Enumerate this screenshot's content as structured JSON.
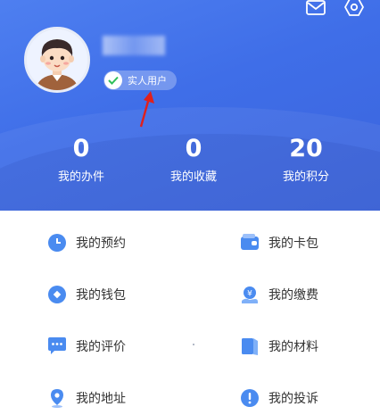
{
  "profile": {
    "verified_label": "实人用户"
  },
  "stats": [
    {
      "value": "0",
      "label": "我的办件"
    },
    {
      "value": "0",
      "label": "我的收藏"
    },
    {
      "value": "20",
      "label": "我的积分"
    }
  ],
  "menu": {
    "appointments": "我的预约",
    "card_wallet": "我的卡包",
    "wallet": "我的钱包",
    "payments": "我的缴费",
    "reviews": "我的评价",
    "materials": "我的材料",
    "address": "我的地址",
    "complaints": "我的投诉"
  },
  "icons": {
    "mail": "mail-icon",
    "settings": "settings-icon",
    "verified": "check-icon"
  },
  "colors": {
    "header_blue": "#4573ea",
    "icon_blue": "#4a8bf0",
    "arrow_red": "#e0201c"
  }
}
